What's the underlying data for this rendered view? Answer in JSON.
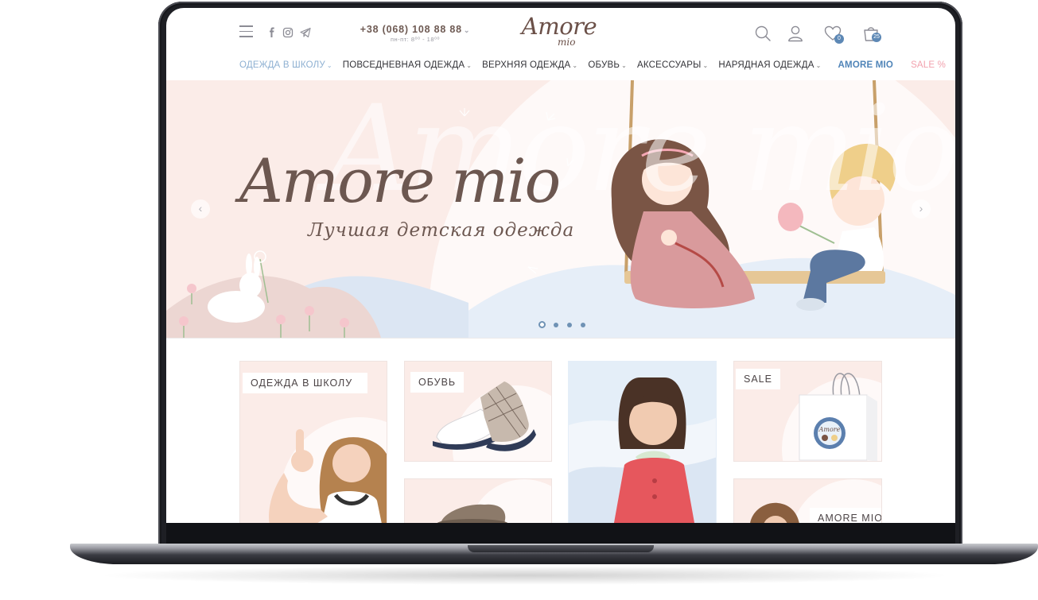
{
  "header": {
    "phone": "+38 (068) 108 88 88",
    "hours": "пн-пт: 8⁰⁰ - 18⁰⁰",
    "logo_main": "Amore",
    "logo_sub": "mio",
    "favorites_count": "0",
    "cart_count": "25",
    "icons": [
      "menu-icon",
      "facebook-icon",
      "instagram-icon",
      "telegram-icon",
      "search-icon",
      "user-icon",
      "heart-icon",
      "cart-icon"
    ]
  },
  "nav": {
    "items": [
      {
        "label": "ОДЕЖДА В ШКОЛУ",
        "caret": "⌄"
      },
      {
        "label": "ПОВСЕДНЕВНАЯ ОДЕЖДА",
        "caret": "⌄"
      },
      {
        "label": "ВЕРХНЯЯ ОДЕЖДА",
        "caret": "⌄"
      },
      {
        "label": "ОБУВЬ",
        "caret": "⌄"
      },
      {
        "label": "АКСЕССУАРЫ",
        "caret": "⌄"
      },
      {
        "label": "НАРЯДНАЯ ОДЕЖДА",
        "caret": "⌄"
      },
      {
        "label": "AMORE MIO"
      },
      {
        "label": "SALE %"
      }
    ],
    "colors": {
      "school": "#8eb0d2",
      "amore": "#4f84b8",
      "sale": "#f2a1ad"
    }
  },
  "hero": {
    "watermark": "Amore mio",
    "title": "Amore mio",
    "subtitle": "Лучшая детская одежда",
    "prev_arrow": "‹",
    "next_arrow": "›",
    "slides_total": 4,
    "active_slide": 1
  },
  "categories": {
    "school": "ОДЕЖДА В ШКОЛУ",
    "shoes": "ОБУВЬ",
    "sale": "SALE",
    "amore": "AMORE MIO"
  }
}
